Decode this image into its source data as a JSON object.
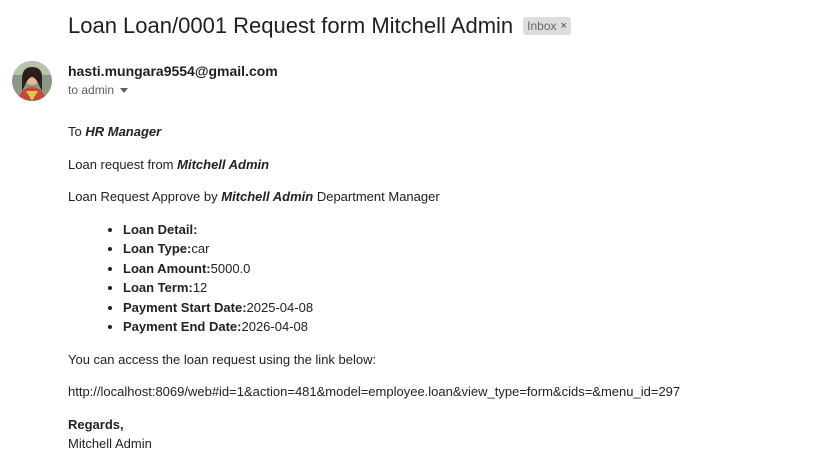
{
  "email": {
    "subject": "Loan Loan/0001 Request form Mitchell Admin",
    "label_chip": "Inbox",
    "label_close": "×",
    "sender": "hasti.mungara9554@gmail.com",
    "to_line": "to admin"
  },
  "body": {
    "greeting_prefix": "To",
    "greeting_name": "HR Manager",
    "request_prefix": "Loan request from",
    "request_name": "Mitchell Admin",
    "approve_prefix": "Loan Request Approve by",
    "approve_name": "Mitchell Admin",
    "approve_suffix": "Department Manager",
    "details": [
      {
        "label": "Loan Detail:",
        "value": ""
      },
      {
        "label": "Loan Type:",
        "value": "car"
      },
      {
        "label": "Loan Amount:",
        "value": "5000.0"
      },
      {
        "label": "Loan Term:",
        "value": "12"
      },
      {
        "label": "Payment Start Date:",
        "value": "2025-04-08"
      },
      {
        "label": "Payment End Date:",
        "value": "2026-04-08"
      }
    ],
    "access_text": "You can access the loan request using the link below:",
    "link": "http://localhost:8069/web#id=1&action=481&model=employee.loan&view_type=form&cids=&menu_id=297",
    "regards": "Regards,",
    "signature": "Mitchell Admin"
  },
  "icons": {
    "avatar": "avatar",
    "chip_close": "close-icon",
    "caret": "chevron-down-icon"
  }
}
